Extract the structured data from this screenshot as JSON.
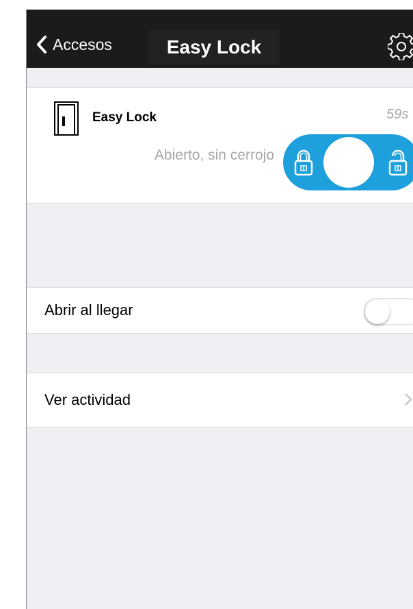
{
  "navbar": {
    "back_label": "Accesos",
    "title": "Easy Lock",
    "back_icon": "chevron-left-icon",
    "settings_icon": "gear-icon"
  },
  "lock_card": {
    "name": "Easy Lock",
    "timer": "59s",
    "status": "Abierto, sin cerrojo",
    "door_icon": "door-icon",
    "toggle_color": "#1ea0dc"
  },
  "settings": {
    "auto_open_label": "Abrir al llegar",
    "auto_open_enabled": false,
    "activity_label": "Ver actividad"
  }
}
